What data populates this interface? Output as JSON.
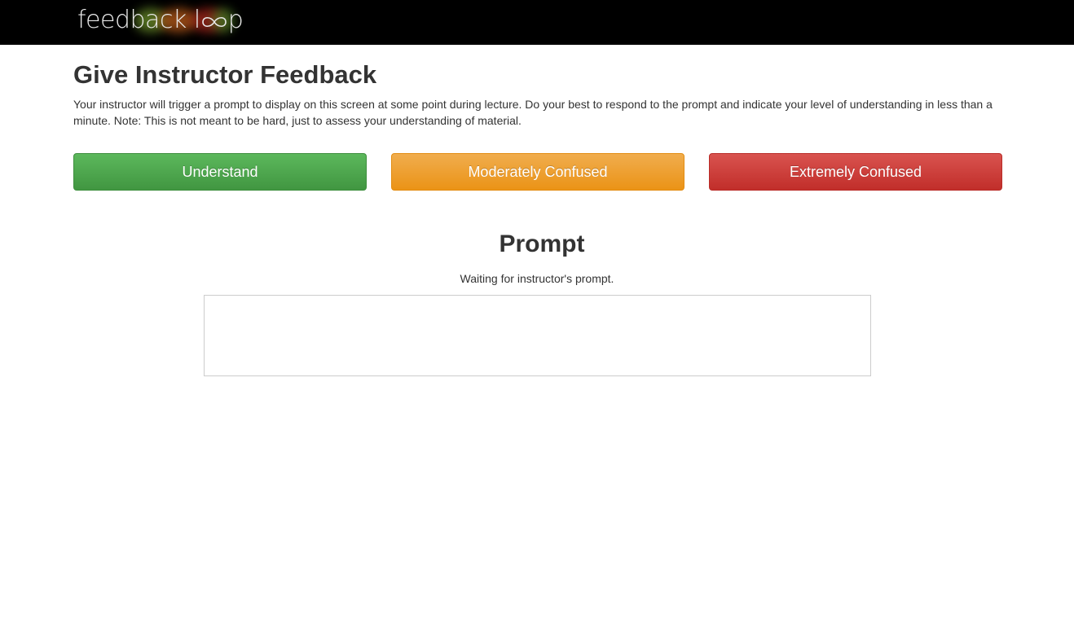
{
  "navbar": {
    "brand_text_start": "feedback l",
    "brand_text_end": "p",
    "brand_logo_icon": "infinity-icon"
  },
  "main": {
    "title": "Give Instructor Feedback",
    "intro": "Your instructor will trigger a prompt to display on this screen at some point during lecture. Do your best to respond to the prompt and indicate your level of understanding in less than a minute. Note: This is not meant to be hard, just to assess your understanding of material.",
    "buttons": {
      "understand": "Understand",
      "moderately_confused": "Moderately Confused",
      "extremely_confused": "Extremely Confused"
    },
    "button_colors": {
      "understand": "#5cb85c",
      "moderately_confused": "#f0ad4e",
      "extremely_confused": "#d9534f"
    }
  },
  "prompt": {
    "title": "Prompt",
    "status": "Waiting for instructor's prompt.",
    "answer_value": "",
    "answer_placeholder": ""
  }
}
